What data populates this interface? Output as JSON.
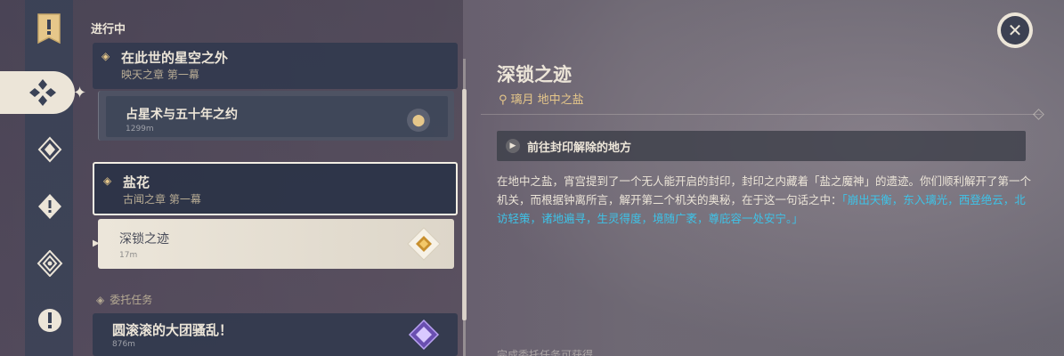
{
  "list": {
    "section_title": "进行中",
    "groups": [
      {
        "title": "在此世的星空之外",
        "subtitle": "映天之章 第一幕",
        "subquests": [
          {
            "title": "占星术与五十年之约",
            "distance": "1299m"
          }
        ]
      },
      {
        "title": "盐花",
        "subtitle": "古闻之章 第一幕",
        "subquests": [
          {
            "title": "深锁之迹",
            "distance": "17m"
          }
        ]
      }
    ],
    "commission_section": "委托任务",
    "commission": {
      "title": "圆滚滚的大团骚乱！",
      "distance": "876m"
    }
  },
  "detail": {
    "title": "深锁之迹",
    "location": "璃月 地中之盐",
    "objective": "前往封印解除的地方",
    "description_plain": "在地中之盐，宵宫提到了一个无人能开启的封印，封印之内藏着「盐之魔神」的遗迹。你们顺利解开了第一个机关，而根据钟离所言，解开第二个机关的奥秘，在于这一句话之中：",
    "description_highlight": "「崩出天衡，东入璃光，西登绝云，北访轻策，诸地遍寻，生灵得度，境随广袤，尊庇容一处安宁。」",
    "bottom_faded": "完成委托任务可获得"
  },
  "colors": {
    "accent_gold": "#e6c78a",
    "highlight_blue": "#3ec3e8",
    "panel_cream": "#ece5d8"
  },
  "icons": [
    "quest-book-icon",
    "archon-quest-icon",
    "story-quest-icon",
    "world-quest-icon",
    "commission-icon",
    "event-quest-icon",
    "close-icon",
    "location-pin-icon",
    "waypoint-marker-icon"
  ]
}
